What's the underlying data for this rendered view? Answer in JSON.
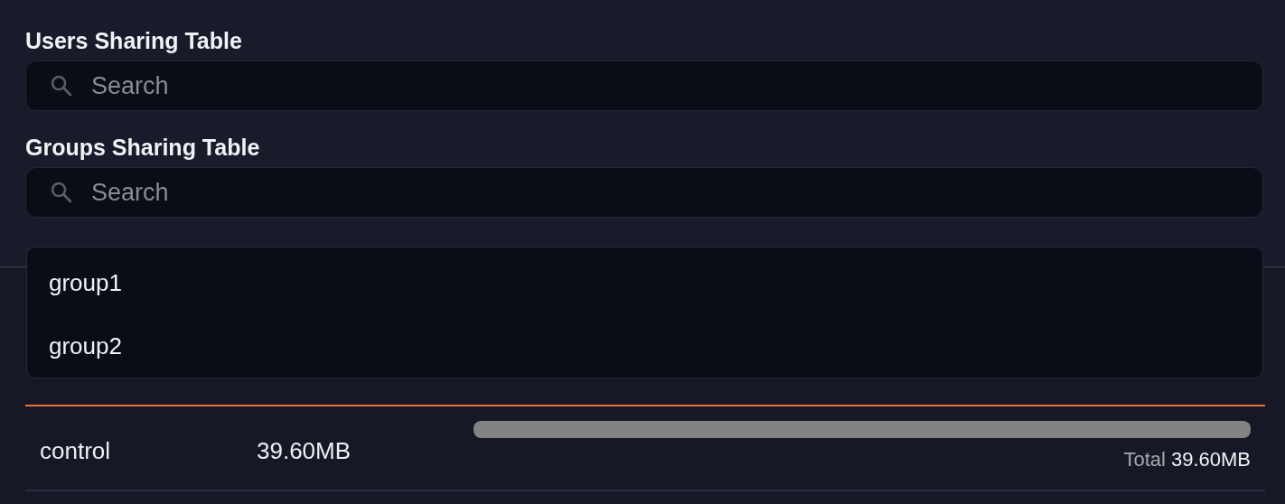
{
  "sections": [
    {
      "title": "Users Sharing Table",
      "search": {
        "placeholder": "Search"
      }
    },
    {
      "title": "Groups Sharing Table",
      "search": {
        "placeholder": "Search"
      },
      "dropdown": {
        "options": [
          "group1",
          "group2"
        ]
      }
    }
  ],
  "table": {
    "rows": [
      {
        "node": "control",
        "capacity": "39.60MB",
        "level": 1,
        "total_label": "Total",
        "total": "39.60MB"
      }
    ]
  }
}
